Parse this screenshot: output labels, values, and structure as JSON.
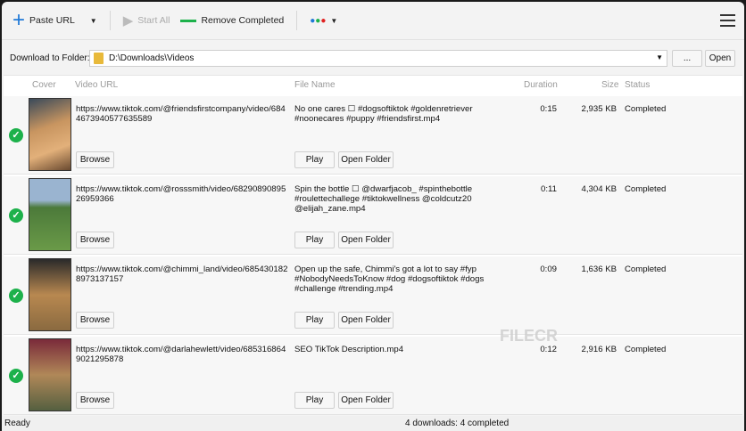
{
  "toolbar": {
    "paste_url": "Paste URL",
    "start_all": "Start All",
    "remove_completed": "Remove Completed"
  },
  "folder": {
    "label": "Download to Folder:",
    "path": "D:\\Downloads\\Videos",
    "browse": "...",
    "open": "Open"
  },
  "columns": [
    "Cover",
    "Video URL",
    "File Name",
    "Duration",
    "Size",
    "Status"
  ],
  "rows": [
    {
      "url": "https://www.tiktok.com/@friendsfirstcompany/video/6844673940577635589",
      "file": "No one cares ☐ #dogsoftiktok #goldenretriever #noonecares #puppy #friendsfirst.mp4",
      "duration": "0:15",
      "size": "2,935 KB",
      "status": "Completed"
    },
    {
      "url": "https://www.tiktok.com/@rosssmith/video/6829089089526959366",
      "file": "Spin the bottle ☐ @dwarfjacob_ #spinthebottle #roulettechallege #tiktokwellness @coldcutz20 @elijah_zane.mp4",
      "duration": "0:11",
      "size": "4,304 KB",
      "status": "Completed"
    },
    {
      "url": "https://www.tiktok.com/@chimmi_land/video/6854301828973137157",
      "file": "Open up the safe, Chimmi's got a lot to say #fyp #NobodyNeedsToKnow #dog #dogsoftiktok #dogs #challenge #trending.mp4",
      "duration": "0:09",
      "size": "1,636 KB",
      "status": "Completed"
    },
    {
      "url": "https://www.tiktok.com/@darlahewlett/video/6853168649021295878",
      "file": "SEO TikTok Description.mp4",
      "duration": "0:12",
      "size": "2,916 KB",
      "status": "Completed"
    }
  ],
  "row_buttons": {
    "browse": "Browse",
    "play": "Play",
    "open_folder": "Open Folder"
  },
  "statusbar": {
    "left": "Ready",
    "center": "4 downloads: 4 completed"
  },
  "watermark": "FILECR",
  "colors": {
    "success": "#1db14b",
    "accent": "#1e78d7"
  }
}
